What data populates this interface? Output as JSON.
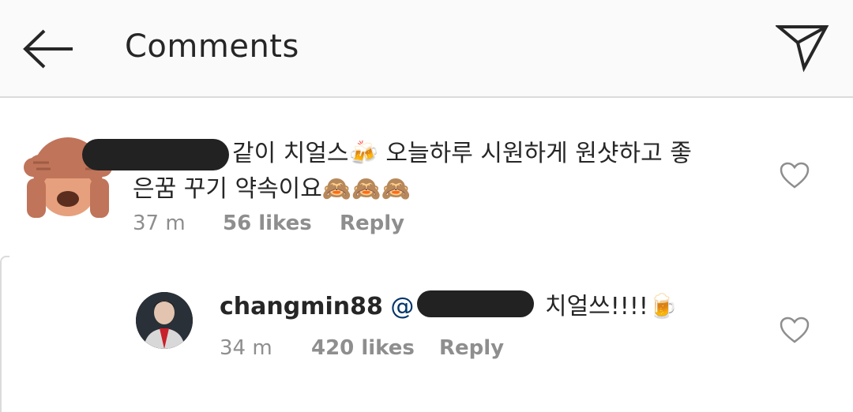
{
  "header": {
    "title": "Comments"
  },
  "comments": [
    {
      "text_line1": "같이 치얼스🍻 오늘하루 시원하게 원샷하고 좋",
      "text_line2": "은꿈 꾸기 약속이요🙈🙈🙈",
      "time": "37 m",
      "likes": "56 likes",
      "reply_label": "Reply"
    }
  ],
  "replies": [
    {
      "username": "changmin88",
      "mention_prefix": "@",
      "text": "치얼쓰!!!!🍺",
      "time": "34 m",
      "likes": "420 likes",
      "reply_label": "Reply"
    }
  ],
  "icons": {
    "back": "back-arrow-icon",
    "send": "send-icon",
    "heart": "heart-icon"
  },
  "colors": {
    "header_bg": "#fafafa",
    "meta": "#8e8e8e",
    "text": "#262626",
    "mention": "#003569"
  }
}
